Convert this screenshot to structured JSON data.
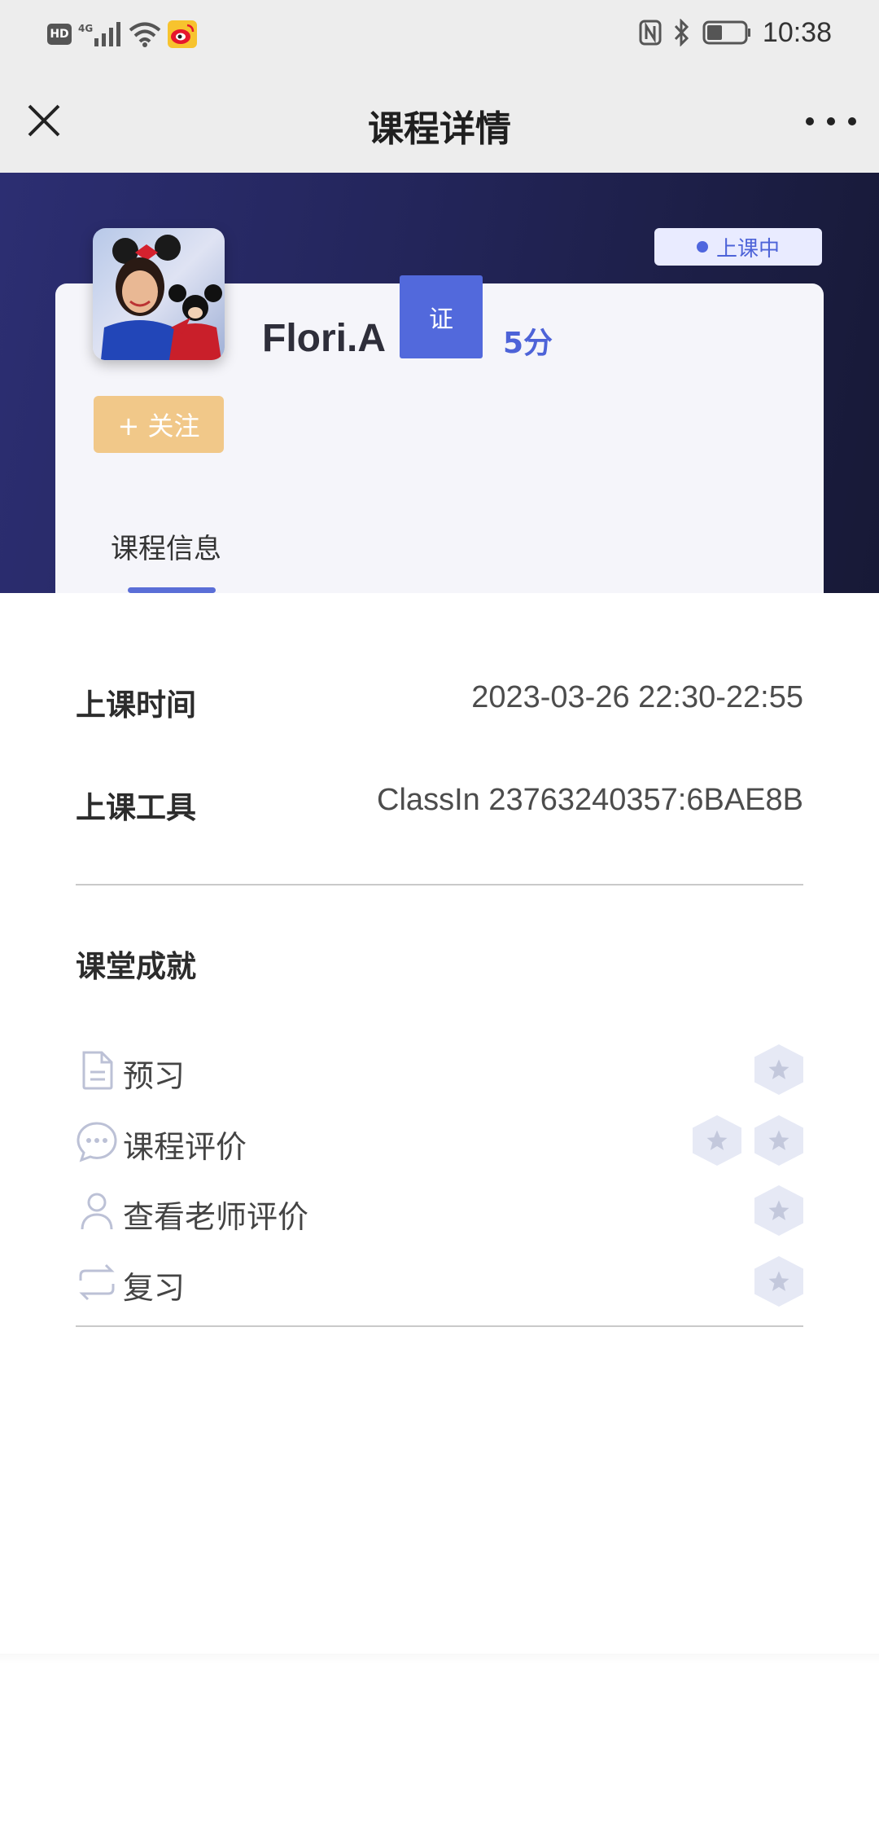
{
  "status_bar": {
    "hd": "HD",
    "network": "4G",
    "time": "10:38"
  },
  "title_bar": {
    "title": "课程详情"
  },
  "teacher": {
    "status": "上课中",
    "name": "Flori.A",
    "cert": "证",
    "score": "5分",
    "follow_label": "+ 关注"
  },
  "tabs": [
    {
      "label": "课程信息",
      "active": true
    }
  ],
  "course_info": {
    "time_label": "上课时间",
    "time_value": "2023-03-26 22:30-22:55",
    "tool_label": "上课工具",
    "tool_value": "ClassIn 23763240357:6BAE8B"
  },
  "achievements": {
    "title": "课堂成就",
    "items": [
      {
        "icon": "document-icon",
        "label": "预习",
        "stars": 1
      },
      {
        "icon": "chat-bubble-icon",
        "label": "课程评价",
        "stars": 2
      },
      {
        "icon": "person-icon",
        "label": "查看老师评价",
        "stars": 1
      },
      {
        "icon": "repeat-icon",
        "label": "复习",
        "stars": 1
      }
    ]
  },
  "colors": {
    "accent": "#4d63d8",
    "hero_dark": "#23255a",
    "follow": "#f1c889",
    "star_bg": "#e6e9f5",
    "star": "#c3c8dc"
  }
}
